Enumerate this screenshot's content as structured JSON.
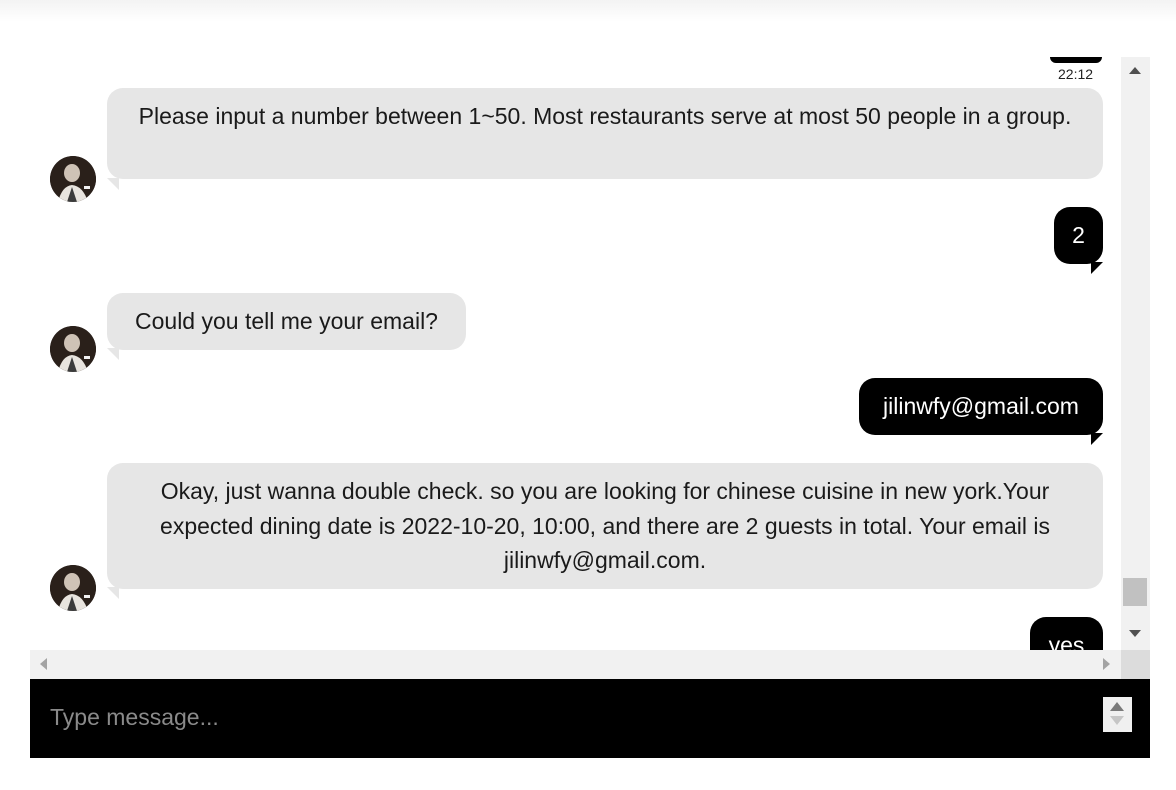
{
  "chat": {
    "top_timestamp": "22:12",
    "messages": [
      {
        "sender": "bot",
        "text": "Please input a number between 1~50. Most restaurants serve at most 50 people in a group."
      },
      {
        "sender": "user",
        "text": "2"
      },
      {
        "sender": "bot",
        "text": "Could you tell me your email?"
      },
      {
        "sender": "user",
        "text": "jilinwfy@gmail.com"
      },
      {
        "sender": "bot",
        "text": "Okay, just wanna double check. so you are looking for chinese cuisine in new york.Your expected dining date is 2022-10-20, 10:00, and there are 2 guests in total. Your email is jilinwfy@gmail.com."
      },
      {
        "sender": "user",
        "text": "yes"
      }
    ]
  },
  "composer": {
    "placeholder": "Type message..."
  },
  "icons": {
    "avatar": "bot-avatar-icon",
    "scroll_up": "scroll-up-arrow-icon",
    "scroll_down": "scroll-down-arrow-icon",
    "scroll_left": "scroll-left-arrow-icon",
    "scroll_right": "scroll-right-arrow-icon",
    "spinner": "input-spinner-icon"
  },
  "colors": {
    "bot_bubble": "#e6e6e6",
    "user_bubble": "#000000",
    "composer_bg": "#000000"
  }
}
